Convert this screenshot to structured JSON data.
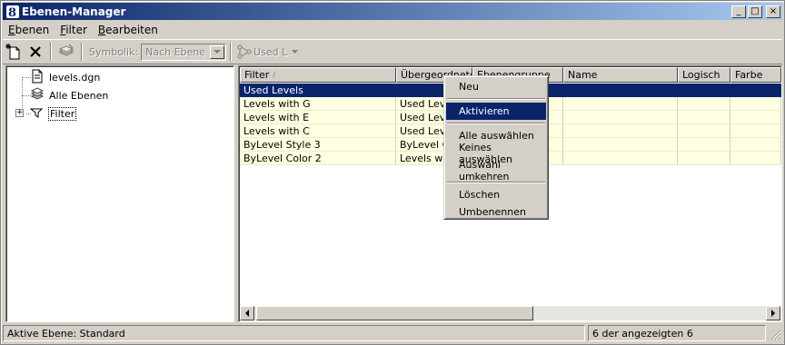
{
  "window": {
    "title": "Ebenen-Manager",
    "buttons": {
      "minimize": "_",
      "maximize": "□",
      "close": "×"
    }
  },
  "menu": {
    "items": [
      "Ebenen",
      "Filter",
      "Bearbeiten"
    ]
  },
  "toolbar": {
    "symbology_label": "Symbolik:",
    "symbology_value": "Nach Ebene",
    "used_label": "Used L"
  },
  "tree": {
    "root": "levels.dgn",
    "all_levels": "Alle Ebenen",
    "filter": "Filter"
  },
  "list": {
    "columns": [
      "Filter",
      "Übergeordneter",
      "Ebenengruppe",
      "Name",
      "Logisch",
      "Farbe"
    ],
    "rows": [
      {
        "filter": "Used Levels",
        "parent": ""
      },
      {
        "filter": "Levels with G",
        "parent": "Used Leve"
      },
      {
        "filter": "Levels with E",
        "parent": "Used Leve"
      },
      {
        "filter": "Levels with C",
        "parent": "Used Leve"
      },
      {
        "filter": "ByLevel Style 3",
        "parent": "ByLevel C"
      },
      {
        "filter": "ByLevel Color 2",
        "parent": "Levels with"
      }
    ]
  },
  "context_menu": {
    "items": [
      "Neu",
      "Aktivieren",
      "Alle auswählen",
      "Keines auswählen",
      "Auswahl umkehren",
      "Löschen",
      "Umbenennen"
    ],
    "highlighted": "Aktivieren"
  },
  "status": {
    "active_level": "Aktive Ebene: Standard",
    "count": "6 der angezeigten 6"
  },
  "colors": {
    "titlebar_start": "#0a246a",
    "titlebar_end": "#a6caf0",
    "row_background": "#ffffe1",
    "selection": "#0a246a",
    "face": "#d4d0c8"
  },
  "icons": [
    "app-icon",
    "new-level-icon",
    "delete-icon",
    "layers-icon",
    "used-levels-icon",
    "file-icon",
    "all-levels-icon",
    "filter-icon",
    "scroll-left-icon",
    "scroll-right-icon",
    "size-grip-icon"
  ]
}
